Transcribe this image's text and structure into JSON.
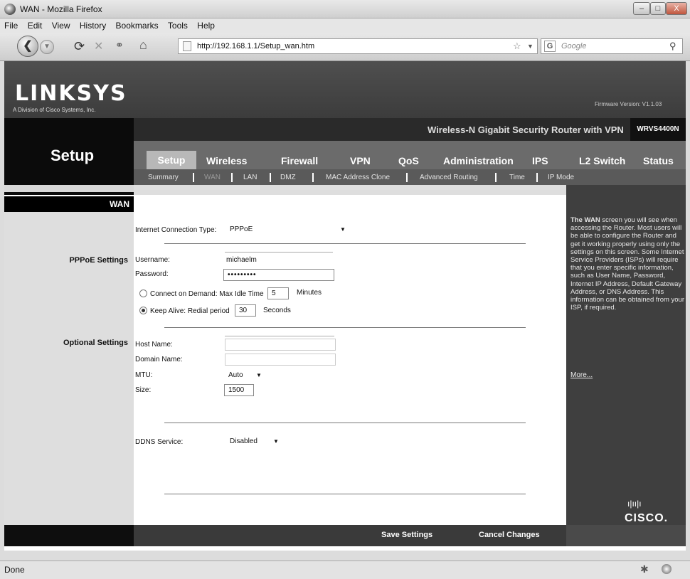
{
  "window": {
    "title": "WAN - Mozilla Firefox"
  },
  "menu": [
    "File",
    "Edit",
    "View",
    "History",
    "Bookmarks",
    "Tools",
    "Help"
  ],
  "browser": {
    "url": "http://192.168.1.1/Setup_wan.htm",
    "search_placeholder": "Google"
  },
  "brand": {
    "logo": "LINKSYS",
    "logo_sub": "A Division of Cisco Systems, Inc.",
    "firmware": "Firmware Version: V1.1.03"
  },
  "product": {
    "name": "Wireless-N Gigabit Security Router with VPN",
    "model": "WRVS4400N"
  },
  "page_section": "Setup",
  "tabs": [
    "Setup",
    "Wireless",
    "Firewall",
    "VPN",
    "QoS",
    "Administration",
    "IPS",
    "L2 Switch",
    "Status"
  ],
  "subtabs": [
    "Summary",
    "WAN",
    "LAN",
    "DMZ",
    "MAC Address Clone",
    "Advanced Routing",
    "Time",
    "IP Mode"
  ],
  "left": {
    "wan": "WAN",
    "pppoe": "PPPoE Settings",
    "optional": "Optional Settings"
  },
  "form": {
    "conn_type_label": "Internet Connection Type:",
    "conn_type_value": "PPPoE",
    "username_label": "Username:",
    "username_value": "michaelm",
    "password_label": "Password:",
    "password_value": "•••••••••",
    "connect_on_demand_label": "Connect on Demand: Max Idle Time",
    "idle_time": "5",
    "minutes": "Minutes",
    "keep_alive_label": "Keep Alive: Redial period",
    "redial_period": "30",
    "seconds": "Seconds",
    "host_label": "Host Name:",
    "domain_label": "Domain Name:",
    "mtu_label": "MTU:",
    "mtu_value": "Auto",
    "size_label": "Size:",
    "size_value": "1500",
    "ddns_label": "DDNS Service:",
    "ddns_value": "Disabled"
  },
  "help": {
    "title": "The WAN",
    "text": "screen you will see when accessing the Router. Most users will be able to configure the Router and get it working properly using only the settings on this screen. Some Internet Service Providers (ISPs) will require that you enter specific information, such as User Name, Password, Internet IP Address, Default Gateway Address, or DNS Address. This information can be obtained from your ISP, if required.",
    "more": "More..."
  },
  "actions": {
    "save": "Save Settings",
    "cancel": "Cancel Changes"
  },
  "cisco": "CISCO.",
  "status": "Done"
}
